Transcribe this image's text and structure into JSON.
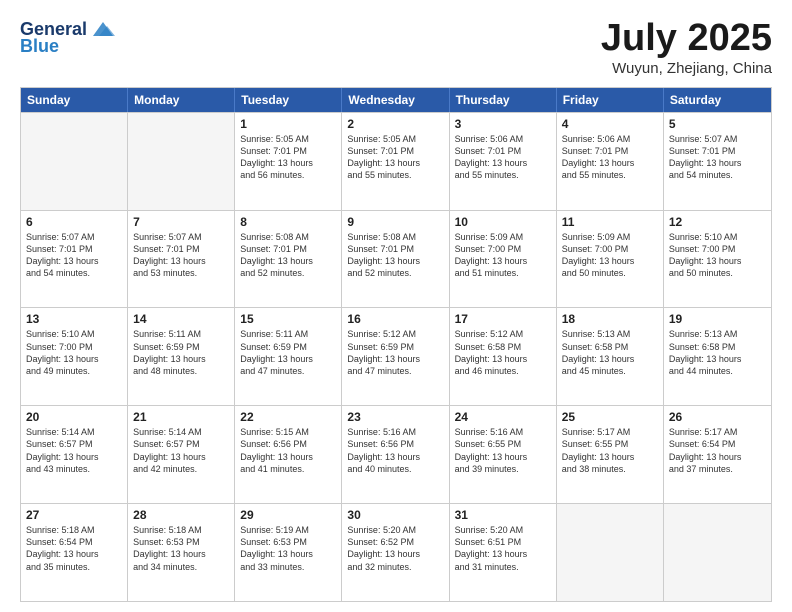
{
  "header": {
    "logo_line1": "General",
    "logo_line2": "Blue",
    "month": "July 2025",
    "location": "Wuyun, Zhejiang, China"
  },
  "days_of_week": [
    "Sunday",
    "Monday",
    "Tuesday",
    "Wednesday",
    "Thursday",
    "Friday",
    "Saturday"
  ],
  "weeks": [
    [
      {
        "day": "",
        "empty": true
      },
      {
        "day": "",
        "empty": true
      },
      {
        "day": "1",
        "sr": "5:05 AM",
        "ss": "7:01 PM",
        "dl": "13 hours and 56 minutes."
      },
      {
        "day": "2",
        "sr": "5:05 AM",
        "ss": "7:01 PM",
        "dl": "13 hours and 55 minutes."
      },
      {
        "day": "3",
        "sr": "5:06 AM",
        "ss": "7:01 PM",
        "dl": "13 hours and 55 minutes."
      },
      {
        "day": "4",
        "sr": "5:06 AM",
        "ss": "7:01 PM",
        "dl": "13 hours and 55 minutes."
      },
      {
        "day": "5",
        "sr": "5:07 AM",
        "ss": "7:01 PM",
        "dl": "13 hours and 54 minutes."
      }
    ],
    [
      {
        "day": "6",
        "sr": "5:07 AM",
        "ss": "7:01 PM",
        "dl": "13 hours and 54 minutes."
      },
      {
        "day": "7",
        "sr": "5:07 AM",
        "ss": "7:01 PM",
        "dl": "13 hours and 53 minutes."
      },
      {
        "day": "8",
        "sr": "5:08 AM",
        "ss": "7:01 PM",
        "dl": "13 hours and 52 minutes."
      },
      {
        "day": "9",
        "sr": "5:08 AM",
        "ss": "7:01 PM",
        "dl": "13 hours and 52 minutes."
      },
      {
        "day": "10",
        "sr": "5:09 AM",
        "ss": "7:00 PM",
        "dl": "13 hours and 51 minutes."
      },
      {
        "day": "11",
        "sr": "5:09 AM",
        "ss": "7:00 PM",
        "dl": "13 hours and 50 minutes."
      },
      {
        "day": "12",
        "sr": "5:10 AM",
        "ss": "7:00 PM",
        "dl": "13 hours and 50 minutes."
      }
    ],
    [
      {
        "day": "13",
        "sr": "5:10 AM",
        "ss": "7:00 PM",
        "dl": "13 hours and 49 minutes."
      },
      {
        "day": "14",
        "sr": "5:11 AM",
        "ss": "6:59 PM",
        "dl": "13 hours and 48 minutes."
      },
      {
        "day": "15",
        "sr": "5:11 AM",
        "ss": "6:59 PM",
        "dl": "13 hours and 47 minutes."
      },
      {
        "day": "16",
        "sr": "5:12 AM",
        "ss": "6:59 PM",
        "dl": "13 hours and 47 minutes."
      },
      {
        "day": "17",
        "sr": "5:12 AM",
        "ss": "6:58 PM",
        "dl": "13 hours and 46 minutes."
      },
      {
        "day": "18",
        "sr": "5:13 AM",
        "ss": "6:58 PM",
        "dl": "13 hours and 45 minutes."
      },
      {
        "day": "19",
        "sr": "5:13 AM",
        "ss": "6:58 PM",
        "dl": "13 hours and 44 minutes."
      }
    ],
    [
      {
        "day": "20",
        "sr": "5:14 AM",
        "ss": "6:57 PM",
        "dl": "13 hours and 43 minutes."
      },
      {
        "day": "21",
        "sr": "5:14 AM",
        "ss": "6:57 PM",
        "dl": "13 hours and 42 minutes."
      },
      {
        "day": "22",
        "sr": "5:15 AM",
        "ss": "6:56 PM",
        "dl": "13 hours and 41 minutes."
      },
      {
        "day": "23",
        "sr": "5:16 AM",
        "ss": "6:56 PM",
        "dl": "13 hours and 40 minutes."
      },
      {
        "day": "24",
        "sr": "5:16 AM",
        "ss": "6:55 PM",
        "dl": "13 hours and 39 minutes."
      },
      {
        "day": "25",
        "sr": "5:17 AM",
        "ss": "6:55 PM",
        "dl": "13 hours and 38 minutes."
      },
      {
        "day": "26",
        "sr": "5:17 AM",
        "ss": "6:54 PM",
        "dl": "13 hours and 37 minutes."
      }
    ],
    [
      {
        "day": "27",
        "sr": "5:18 AM",
        "ss": "6:54 PM",
        "dl": "13 hours and 35 minutes."
      },
      {
        "day": "28",
        "sr": "5:18 AM",
        "ss": "6:53 PM",
        "dl": "13 hours and 34 minutes."
      },
      {
        "day": "29",
        "sr": "5:19 AM",
        "ss": "6:53 PM",
        "dl": "13 hours and 33 minutes."
      },
      {
        "day": "30",
        "sr": "5:20 AM",
        "ss": "6:52 PM",
        "dl": "13 hours and 32 minutes."
      },
      {
        "day": "31",
        "sr": "5:20 AM",
        "ss": "6:51 PM",
        "dl": "13 hours and 31 minutes."
      },
      {
        "day": "",
        "empty": true
      },
      {
        "day": "",
        "empty": true
      }
    ]
  ],
  "labels": {
    "sunrise": "Sunrise:",
    "sunset": "Sunset:",
    "daylight": "Daylight: 13 hours"
  }
}
